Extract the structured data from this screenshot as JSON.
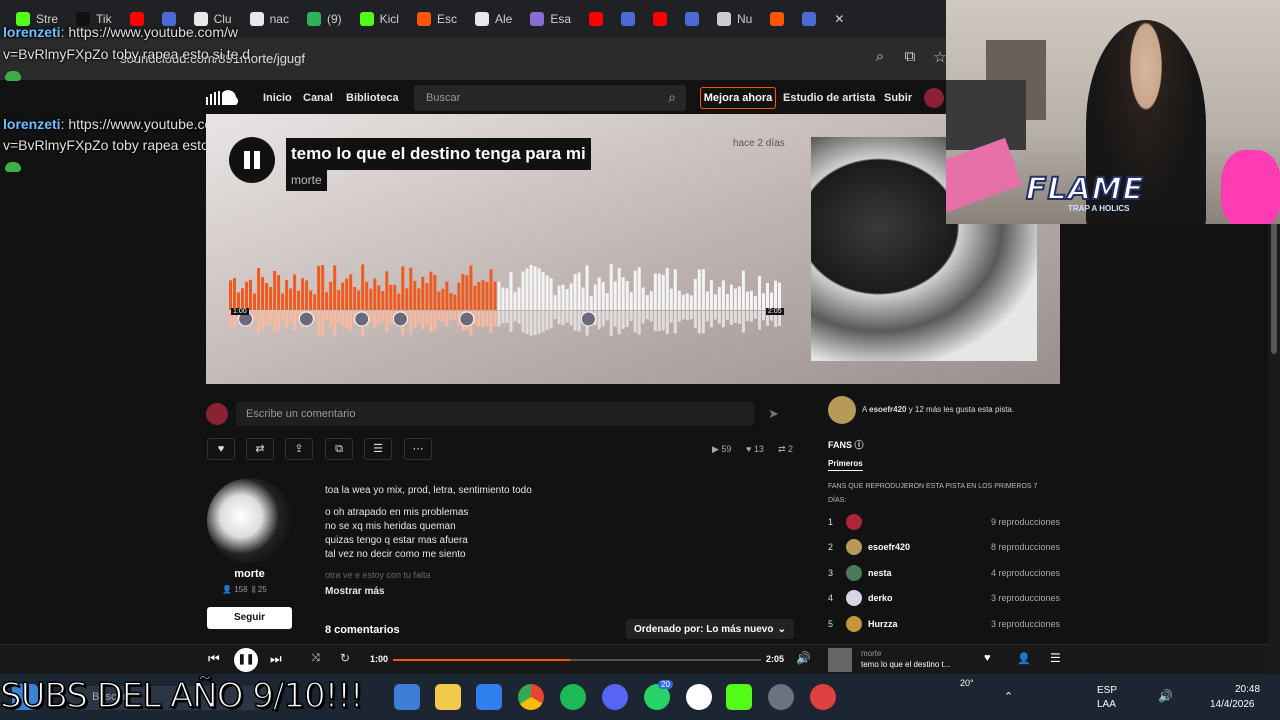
{
  "browser": {
    "tabs": [
      {
        "label": "Stre",
        "color": "#53fc18"
      },
      {
        "label": "Tik",
        "color": "#111111"
      },
      {
        "label": "",
        "color": "#ff0000"
      },
      {
        "label": "",
        "color": "#4a6cd4"
      },
      {
        "label": "Clu",
        "color": "#e8e8e8"
      },
      {
        "label": "nac",
        "color": "#e8e8e8"
      },
      {
        "label": "(9)",
        "color": "#2db35d"
      },
      {
        "label": "Kicl",
        "color": "#53fc18"
      },
      {
        "label": "Esc",
        "color": "#ff5500"
      },
      {
        "label": "Ale",
        "color": "#e8e8e8"
      },
      {
        "label": "Esa",
        "color": "#8a6bd8"
      },
      {
        "label": "",
        "color": "#ff0000"
      },
      {
        "label": "",
        "color": "#4a6cd4"
      },
      {
        "label": "",
        "color": "#ff0000"
      },
      {
        "label": "",
        "color": "#4a6cd4"
      },
      {
        "label": "Nu",
        "color": "#cccccc"
      },
      {
        "label": "",
        "color": "#ff5500"
      },
      {
        "label": "",
        "color": "#4a6cd4"
      }
    ],
    "address": "soundcloud.com/891morte/jgugf",
    "close_glyph": "✕"
  },
  "chat": {
    "messages": [
      {
        "user": "lorenzeti",
        "line1": ": https://www.youtube.com/w",
        "line2": "v=BvRlmyFXpZo toby rapea esto si te d"
      }
    ],
    "line2_top": "v=BvRlmyFXpZo toby rapea esto si te.d"
  },
  "soundcloud": {
    "nav": {
      "home": "Inicio",
      "feed": "Canal",
      "library": "Biblioteca",
      "upgrade": "Mejora ahora",
      "studio": "Estudio de artista",
      "upload": "Subir"
    },
    "search_placeholder": "Buscar",
    "track": {
      "title": "temo lo que el destino tenga para mi",
      "artist": "morte",
      "posted": "hace 2 días",
      "elapsed_label": "1:00",
      "duration_label": "2:05",
      "progress": 0.48
    },
    "comment_placeholder": "Escribe un comentario",
    "stats": {
      "plays": "59",
      "likes": "13",
      "reposts": "2"
    },
    "artist_card": {
      "name": "morte",
      "followers": "158",
      "tracks": "25",
      "follow": "Seguir"
    },
    "description": {
      "line0": "toa la wea yo mix, prod, letra, sentimiento todo",
      "lyrics": [
        "o oh atrapado en mis problemas",
        "no se xq mis heridas queman",
        "quizas tengo q estar mas afuera",
        "tal vez no decir como me siento"
      ],
      "faded": "otra ve e estoy con tu falta",
      "more": "Mostrar más"
    },
    "comments_count": "8 comentarios",
    "sort": "Ordenado por: Lo más nuevo",
    "likes_line": {
      "prefix": "A ",
      "user": "esoefr420",
      "suffix": " y 12 más les gusta esta pista."
    },
    "fans": {
      "title": "FANS",
      "tab": "Primeros",
      "subtitle": "FANS QUE REPRODUJERON ESTA PISTA EN LOS PRIMEROS 7",
      "subtitle2": "DÍAS:",
      "rows": [
        {
          "rank": "1",
          "name": "",
          "plays": "9 reproducciones",
          "color": "#b0243a"
        },
        {
          "rank": "2",
          "name": "esoefr420",
          "plays": "8 reproducciones",
          "color": "#b79a5a"
        },
        {
          "rank": "3",
          "name": "nesta",
          "plays": "4 reproducciones",
          "color": "#4a7a5a"
        },
        {
          "rank": "4",
          "name": "derko",
          "plays": "3 reproducciones",
          "color": "#d6d6e6"
        },
        {
          "rank": "5",
          "name": "Hurzza",
          "plays": "3 reproducciones",
          "color": "#c09a3a"
        }
      ]
    }
  },
  "player": {
    "elapsed": "1:00",
    "duration": "2:05",
    "progress": 0.48,
    "artist": "morte",
    "title": "temo lo que el destino t..."
  },
  "taskbar": {
    "search_label": "Buscar",
    "language": "ESP",
    "layout": "LAA",
    "time": "20:48",
    "date": "14/4/2026",
    "temp": "20°",
    "badge1": "20"
  },
  "overlay": {
    "subs_text": "SUBS DEL AÑO 9/10!!!",
    "flame_text": "FLAME",
    "flame_sub": "TRAP A HOLICS"
  }
}
